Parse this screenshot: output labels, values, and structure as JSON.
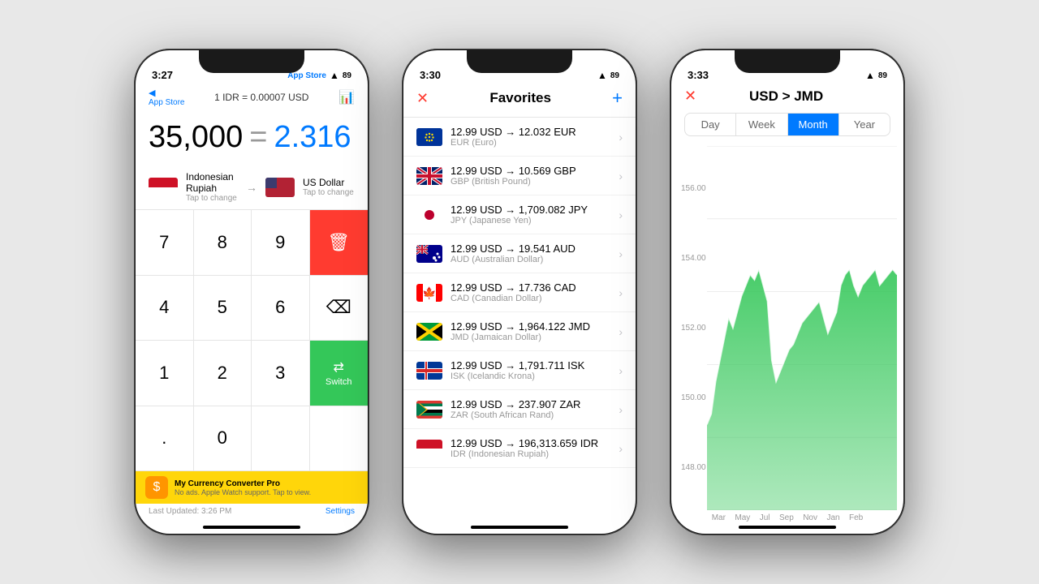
{
  "phones": [
    {
      "id": "phone1",
      "status": {
        "time": "3:27",
        "battery": "89",
        "store_label": "App Store"
      },
      "header": {
        "rate_label": "1 IDR = 0.00007 USD"
      },
      "converter": {
        "input": "35,000",
        "equals": "=",
        "result": "2.316"
      },
      "from_currency": {
        "name": "Indonesian Rupiah",
        "tap": "Tap to change"
      },
      "to_currency": {
        "name": "US Dollar",
        "tap": "Tap to change"
      },
      "keypad": [
        "7",
        "8",
        "9",
        "DEL",
        "4",
        "5",
        "6",
        "⌫",
        "1",
        "2",
        "3",
        "Switch",
        ".",
        "0",
        "",
        ""
      ],
      "ad": {
        "title": "My Currency Converter Pro",
        "subtitle": "No ads. Apple Watch support. Tap to view."
      },
      "footer": {
        "last_updated": "Last Updated: 3:26 PM",
        "settings": "Settings"
      }
    },
    {
      "id": "phone2",
      "status": {
        "time": "3:30",
        "battery": "89"
      },
      "header": {
        "title": "Favorites"
      },
      "favorites": [
        {
          "flag": "eu",
          "conversion": "12.99 USD → 12.032 EUR",
          "name": "EUR (Euro)"
        },
        {
          "flag": "gb",
          "conversion": "12.99 USD → 10.569 GBP",
          "name": "GBP (British Pound)"
        },
        {
          "flag": "jp",
          "conversion": "12.99 USD → 1,709.082 JPY",
          "name": "JPY (Japanese Yen)"
        },
        {
          "flag": "au",
          "conversion": "12.99 USD → 19.541 AUD",
          "name": "AUD (Australian Dollar)"
        },
        {
          "flag": "ca",
          "conversion": "12.99 USD → 17.736 CAD",
          "name": "CAD (Canadian Dollar)"
        },
        {
          "flag": "jm",
          "conversion": "12.99 USD → 1,964.122 JMD",
          "name": "JMD (Jamaican Dollar)"
        },
        {
          "flag": "is",
          "conversion": "12.99 USD → 1,791.711 ISK",
          "name": "ISK (Icelandic Krona)"
        },
        {
          "flag": "za",
          "conversion": "12.99 USD → 237.907 ZAR",
          "name": "ZAR (South African Rand)"
        },
        {
          "flag": "id",
          "conversion": "12.99 USD → 196,313.659 IDR",
          "name": "IDR (Indonesian Rupiah)"
        }
      ]
    },
    {
      "id": "phone3",
      "status": {
        "time": "3:33",
        "battery": "89"
      },
      "header": {
        "title": "USD > JMD"
      },
      "time_tabs": [
        "Day",
        "Week",
        "Month",
        "Year"
      ],
      "active_tab": "Month",
      "y_labels": [
        "156.00",
        "154.00",
        "152.00",
        "150.00",
        "148.00"
      ],
      "x_labels": [
        "Mar",
        "May",
        "Jul",
        "Sep",
        "Nov",
        "Jan",
        "Feb"
      ]
    }
  ]
}
